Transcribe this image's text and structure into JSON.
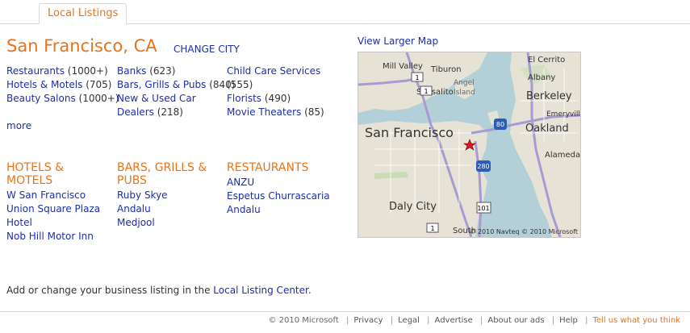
{
  "tab": {
    "label": "Local Listings"
  },
  "city": {
    "name": "San Francisco, CA",
    "change_label": "CHANGE CITY"
  },
  "categories": [
    [
      {
        "name": "Restaurants",
        "count": " (1000+)"
      },
      {
        "name": "Hotels & Motels",
        "count": " (705)"
      },
      {
        "name": "Beauty Salons",
        "count": " (1000+)"
      }
    ],
    [
      {
        "name": "Banks",
        "count": " (623)"
      },
      {
        "name": "Bars, Grills & Pubs",
        "count": " (840)"
      },
      {
        "name": "New & Used Car",
        "cont": "Dealers",
        "count": " (218)"
      }
    ],
    [
      {
        "name": "Child Care Services",
        "cont": "",
        "count": "(555)"
      },
      {
        "name": "Florists",
        "count": " (490)"
      },
      {
        "name": "Movie Theaters",
        "count": " (85)"
      }
    ]
  ],
  "more_label": "more",
  "sections": [
    {
      "heading": "HOTELS & MOTELS",
      "items": [
        "W San Francisco",
        "Union Square Plaza Hotel",
        "Nob Hill Motor Inn"
      ]
    },
    {
      "heading": "BARS, GRILLS & PUBS",
      "items": [
        "Ruby Skye",
        "Andalu",
        "Medjool"
      ]
    },
    {
      "heading": "RESTAURANTS",
      "items": [
        "ANZU",
        "Espetus Churrascaria",
        "Andalu"
      ]
    }
  ],
  "map": {
    "link_label": "View Larger Map",
    "labels": {
      "sf": "San Francisco",
      "oakland": "Oakland",
      "berkeley": "Berkeley",
      "daly": "Daly City",
      "sausalito": "Sausalito",
      "millvalley": "Mill Valley",
      "tiburon": "Tiburon",
      "angel": "Angel",
      "island": "Island",
      "elcerrito": "El Cerrito",
      "albany": "Albany",
      "emeryville": "Emeryville",
      "alameda": "Alameda",
      "south": "South"
    },
    "shields": {
      "r1": "1",
      "r1b": "1",
      "i80": "80",
      "i280": "280",
      "r101": "101",
      "r1c": "1"
    },
    "copyright": "© 2010 Navteq © 2010 Microsoft"
  },
  "footnote": {
    "prefix": "Add or change your business listing in the ",
    "link": "Local Listing Center",
    "suffix": "."
  },
  "footer": {
    "copyright": "© 2010 Microsoft",
    "links": [
      "Privacy",
      "Legal",
      "Advertise",
      "About our ads",
      "Help"
    ],
    "tell_a": "Tell us",
    "tell_b": " what you think"
  },
  "colors": {
    "accent": "#e8731a",
    "link": "#1a2fa8",
    "water": "#b3cfd8",
    "land": "#e6e2d6",
    "road": "#a79bd3"
  }
}
